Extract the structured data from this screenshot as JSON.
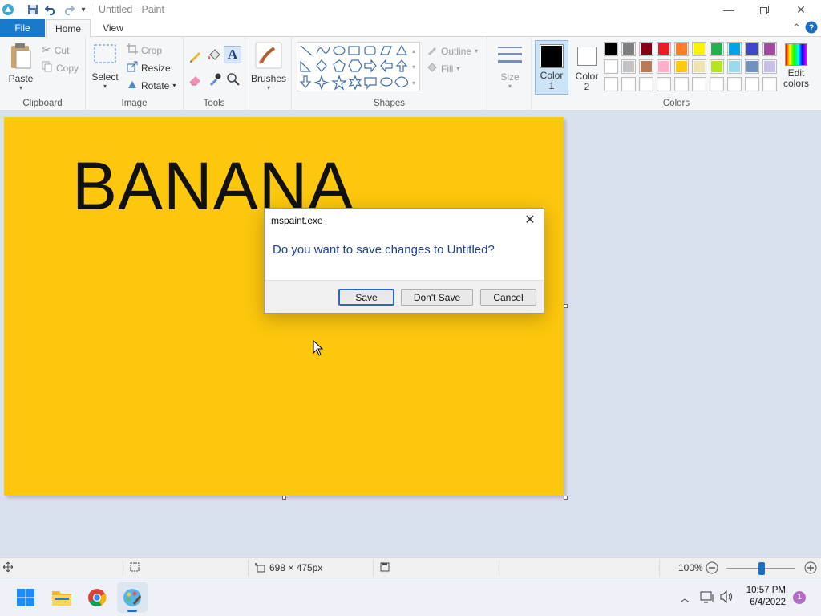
{
  "window": {
    "title": "Untitled - Paint",
    "quick_access": [
      "paint-app-icon",
      "save-icon",
      "undo-icon",
      "redo-icon",
      "customize-dropdown-icon"
    ],
    "controls": [
      "minimize-icon",
      "restore-icon",
      "close-icon"
    ]
  },
  "tabs": {
    "file": "File",
    "home": "Home",
    "view": "View",
    "active": "Home"
  },
  "ribbon": {
    "clipboard": {
      "label": "Clipboard",
      "paste": "Paste",
      "cut": "Cut",
      "copy": "Copy"
    },
    "image": {
      "label": "Image",
      "select": "Select",
      "crop": "Crop",
      "resize": "Resize",
      "rotate": "Rotate"
    },
    "tools": {
      "label": "Tools"
    },
    "brushes": {
      "label": "Brushes"
    },
    "shapes": {
      "label": "Shapes",
      "outline": "Outline",
      "fill": "Fill"
    },
    "size": {
      "label": "Size"
    },
    "colors": {
      "label": "Colors",
      "color1_line1": "Color",
      "color1_line2": "1",
      "color2_line1": "Color",
      "color2_line2": "2",
      "edit_line1": "Edit",
      "edit_line2": "colors",
      "color1": "#000000",
      "color2": "#ffffff",
      "palette_row1": [
        "#000000",
        "#7f7f7f",
        "#880015",
        "#ed1c24",
        "#ff7f27",
        "#fff200",
        "#22b14c",
        "#00a2e8",
        "#3f48cc",
        "#a349a4"
      ],
      "palette_row2": [
        "#ffffff",
        "#c3c3c3",
        "#b97a57",
        "#ffaec9",
        "#ffc90e",
        "#efe4b0",
        "#b5e61d",
        "#99d9ea",
        "#7092be",
        "#c8bfe7"
      ],
      "palette_row3": [
        "#ffffff",
        "#ffffff",
        "#ffffff",
        "#ffffff",
        "#ffffff",
        "#ffffff",
        "#ffffff",
        "#ffffff",
        "#ffffff",
        "#ffffff"
      ]
    }
  },
  "canvas": {
    "text": "BANANA",
    "background": "#fdc70d"
  },
  "dialog": {
    "title": "mspaint.exe",
    "message": "Do you want to save changes to Untitled?",
    "save": "Save",
    "dont_save": "Don't Save",
    "cancel": "Cancel"
  },
  "status": {
    "dimensions": "698 × 475px",
    "zoom": "100%"
  },
  "taskbar": {
    "apps": [
      "windows-start-icon",
      "file-explorer-icon",
      "chrome-icon",
      "paint-icon"
    ],
    "time": "10:57 PM",
    "date": "6/4/2022",
    "notifications": "1"
  }
}
